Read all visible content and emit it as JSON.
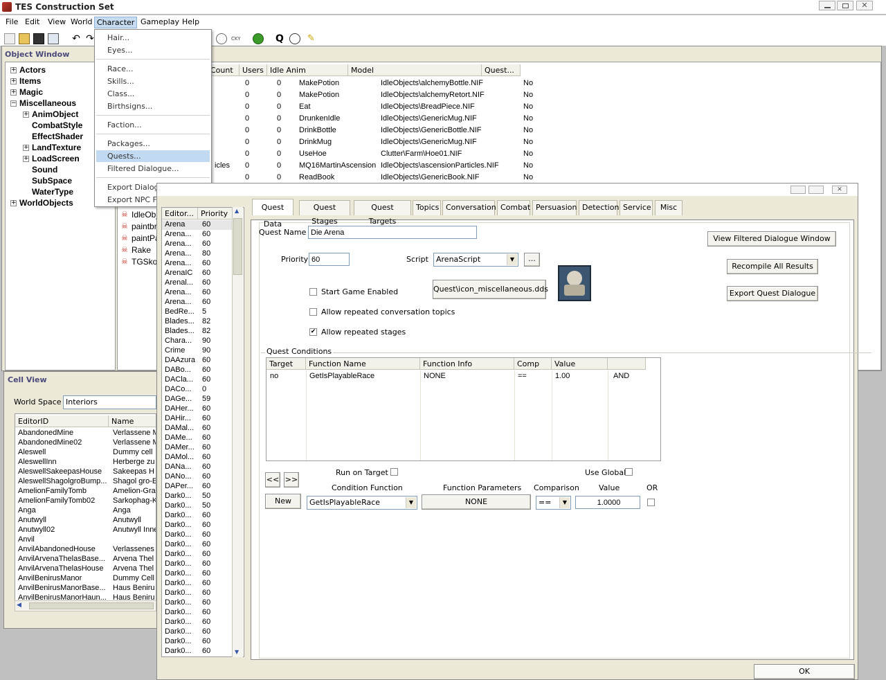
{
  "app": {
    "title": "TES Construction Set"
  },
  "menubar": [
    "File",
    "Edit",
    "View",
    "World",
    "Character",
    "Gameplay",
    "Help"
  ],
  "character_menu": {
    "groups": [
      [
        "Hair...",
        "Eyes..."
      ],
      [
        "Race...",
        "Skills...",
        "Class...",
        "Birthsigns..."
      ],
      [
        "Faction..."
      ],
      [
        "Packages...",
        "Quests...",
        "Filtered Dialogue..."
      ],
      [
        "Export Dialogue...",
        "Export NPC Face Textures"
      ]
    ],
    "highlighted": "Quests..."
  },
  "object_window": {
    "title": "Object Window",
    "tree": [
      {
        "label": "Actors",
        "level": 0,
        "expander": "+"
      },
      {
        "label": "Items",
        "level": 0,
        "expander": "+"
      },
      {
        "label": "Magic",
        "level": 0,
        "expander": "+"
      },
      {
        "label": "Miscellaneous",
        "level": 0,
        "expander": "−"
      },
      {
        "label": "AnimObject",
        "level": 1,
        "expander": "+"
      },
      {
        "label": "CombatStyle",
        "level": 1,
        "expander": ""
      },
      {
        "label": "EffectShader",
        "level": 1,
        "expander": ""
      },
      {
        "label": "LandTexture",
        "level": 1,
        "expander": "+"
      },
      {
        "label": "LoadScreen",
        "level": 1,
        "expander": "+"
      },
      {
        "label": "Sound",
        "level": 1,
        "expander": ""
      },
      {
        "label": "SubSpace",
        "level": 1,
        "expander": ""
      },
      {
        "label": "WaterType",
        "level": 1,
        "expander": ""
      },
      {
        "label": "WorldObjects",
        "level": 0,
        "expander": "+"
      }
    ],
    "columns": [
      "Count",
      "Users",
      "Idle Anim",
      "Model",
      "Quest..."
    ],
    "rows": [
      [
        "0",
        "0",
        "MakePotion",
        "IdleObjects\\alchemyBottle.NIF",
        "No"
      ],
      [
        "0",
        "0",
        "MakePotion",
        "IdleObjects\\alchemyRetort.NIF",
        "No"
      ],
      [
        "0",
        "0",
        "Eat",
        "IdleObjects\\BreadPiece.NIF",
        "No"
      ],
      [
        "0",
        "0",
        "DrunkenIdle",
        "IdleObjects\\GenericMug.NIF",
        "No"
      ],
      [
        "0",
        "0",
        "DrinkBottle",
        "IdleObjects\\GenericBottle.NIF",
        "No"
      ],
      [
        "0",
        "0",
        "DrinkMug",
        "IdleObjects\\GenericMug.NIF",
        "No"
      ],
      [
        "0",
        "0",
        "UseHoe",
        "Clutter\\Farm\\Hoe01.NIF",
        "No"
      ],
      [
        "0",
        "0",
        "MQ16MartinAscension",
        "IdleObjects\\ascensionParticles.NIF",
        "No"
      ],
      [
        "0",
        "0",
        "ReadBook",
        "IdleObjects\\GenericBook.NIF",
        "No"
      ]
    ],
    "partial_label": "icles",
    "lower_items": [
      "IdleObj",
      "paintbru",
      "paintPa",
      "Rake",
      "TGSko"
    ]
  },
  "cell_view": {
    "title": "Cell View",
    "world_space_label": "World Space",
    "world_space_value": "Interiors",
    "columns": [
      "EditorID",
      "Name"
    ],
    "rows": [
      [
        "AbandonedMine",
        "Verlassene M"
      ],
      [
        "AbandonedMine02",
        "Verlassene M"
      ],
      [
        "Aleswell",
        "Dummy cell"
      ],
      [
        "AleswellInn",
        "Herberge zu"
      ],
      [
        "AleswellSakeepasHouse",
        "Sakeepas H"
      ],
      [
        "AleswellShagolgroBump...",
        "Shagol gro-E"
      ],
      [
        "AmelionFamilyTomb",
        "Amelion-Gral"
      ],
      [
        "AmelionFamilyTomb02",
        "Sarkophag-K"
      ],
      [
        "Anga",
        "Anga"
      ],
      [
        "Anutwyll",
        "Anutwyll"
      ],
      [
        "Anutwyll02",
        "Anutwyll Inne"
      ],
      [
        "Anvil",
        ""
      ],
      [
        "AnvilAbandonedHouse",
        "Verlassenes"
      ],
      [
        "AnvilArvenaThelasBase...",
        "Arvena Thel"
      ],
      [
        "AnvilArvenaThelasHouse",
        "Arvena Thel"
      ],
      [
        "AnvilBenirusManor",
        "Dummy Cell"
      ],
      [
        "AnvilBenirusManorBase...",
        "Haus Beniru"
      ],
      [
        "AnvilBenirusManorHaun...",
        "Haus Beniru"
      ]
    ]
  },
  "quest_list": {
    "columns": [
      "Editor...",
      "Priority"
    ],
    "rows": [
      [
        "Arena",
        "60"
      ],
      [
        "Arena...",
        "60"
      ],
      [
        "Arena...",
        "60"
      ],
      [
        "Arena...",
        "80"
      ],
      [
        "Arena...",
        "60"
      ],
      [
        "ArenaIC",
        "60"
      ],
      [
        "Arenal...",
        "60"
      ],
      [
        "Arena...",
        "60"
      ],
      [
        "Arena...",
        "60"
      ],
      [
        "BedRe...",
        "5"
      ],
      [
        "Blades...",
        "82"
      ],
      [
        "Blades...",
        "82"
      ],
      [
        "Chara...",
        "90"
      ],
      [
        "Crime",
        "90"
      ],
      [
        "DAAzura",
        "60"
      ],
      [
        "DABo...",
        "60"
      ],
      [
        "DACla...",
        "60"
      ],
      [
        "DACo...",
        "0"
      ],
      [
        "DAGe...",
        "59"
      ],
      [
        "DAHer...",
        "60"
      ],
      [
        "DAHir...",
        "60"
      ],
      [
        "DAMal...",
        "60"
      ],
      [
        "DAMe...",
        "60"
      ],
      [
        "DAMer...",
        "60"
      ],
      [
        "DAMol...",
        "60"
      ],
      [
        "DANa...",
        "60"
      ],
      [
        "DANo...",
        "60"
      ],
      [
        "DAPer...",
        "60"
      ],
      [
        "Dark0...",
        "50"
      ],
      [
        "Dark0...",
        "50"
      ],
      [
        "Dark0...",
        "60"
      ],
      [
        "Dark0...",
        "60"
      ],
      [
        "Dark0...",
        "60"
      ],
      [
        "Dark0...",
        "60"
      ],
      [
        "Dark0...",
        "60"
      ],
      [
        "Dark0...",
        "60"
      ],
      [
        "Dark0...",
        "60"
      ],
      [
        "Dark0...",
        "60"
      ],
      [
        "Dark0...",
        "60"
      ],
      [
        "Dark0...",
        "60"
      ],
      [
        "Dark0...",
        "60"
      ],
      [
        "Dark0...",
        "60"
      ],
      [
        "Dark0...",
        "60"
      ],
      [
        "Dark0...",
        "60"
      ],
      [
        "Dark0...",
        "60"
      ],
      [
        "Dark0...",
        "60"
      ]
    ]
  },
  "quest_tabs": [
    "Quest Data",
    "Quest Stages",
    "Quest Targets",
    "Topics",
    "Conversation",
    "Combat",
    "Persuasion",
    "Detection",
    "Service",
    "Misc"
  ],
  "quest_data": {
    "name_label": "Quest Name",
    "name_value": "Die Arena",
    "priority_label": "Priority",
    "priority_value": "60",
    "script_label": "Script",
    "script_value": "ArenaScript",
    "ellipsis": "...",
    "icon_button": "Quest\\icon_miscellaneous.dds",
    "start_enabled": "Start Game Enabled",
    "allow_repeat_topics": "Allow repeated conversation topics",
    "allow_repeat_stages": "Allow repeated stages",
    "view_filtered": "View Filtered Dialogue Window",
    "recompile": "Recompile All Results",
    "export": "Export Quest Dialogue",
    "conditions_title": "Quest Conditions",
    "cond_columns": [
      "Target",
      "Function Name",
      "Function Info",
      "Comp",
      "Value",
      ""
    ],
    "cond_row": [
      "no",
      "GetIsPlayableRace",
      "NONE",
      "==",
      "1.00",
      "AND"
    ],
    "run_on_target": "Run on Target",
    "use_global": "Use Global",
    "prev": "<<",
    "next": ">>",
    "new": "New",
    "condition_function_label": "Condition Function",
    "condition_function_value": "GetIsPlayableRace",
    "function_params_label": "Function Parameters",
    "function_params_value": "NONE",
    "comparison_label": "Comparison",
    "comparison_value": "==",
    "value_label": "Value",
    "value_value": "1.0000",
    "or_label": "OR",
    "ok": "OK"
  }
}
